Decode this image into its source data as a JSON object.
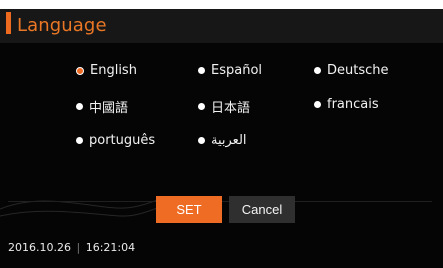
{
  "title": "Language",
  "options": [
    {
      "label": "English",
      "selected": true
    },
    {
      "label": "Español",
      "selected": false
    },
    {
      "label": "Deutsche",
      "selected": false
    },
    {
      "label": "中國語",
      "selected": false
    },
    {
      "label": "日本語",
      "selected": false
    },
    {
      "label": "francais",
      "selected": false
    },
    {
      "label": "português",
      "selected": false
    },
    {
      "label": "العربية",
      "selected": false
    }
  ],
  "buttons": {
    "set": "SET",
    "cancel": "Cancel"
  },
  "status": {
    "date": "2016.10.26",
    "time": "16:21:04"
  },
  "colors": {
    "accent": "#ee6a1f",
    "background": "#050505",
    "title_bar": "#171717",
    "cancel_button": "#2f2f2f"
  }
}
